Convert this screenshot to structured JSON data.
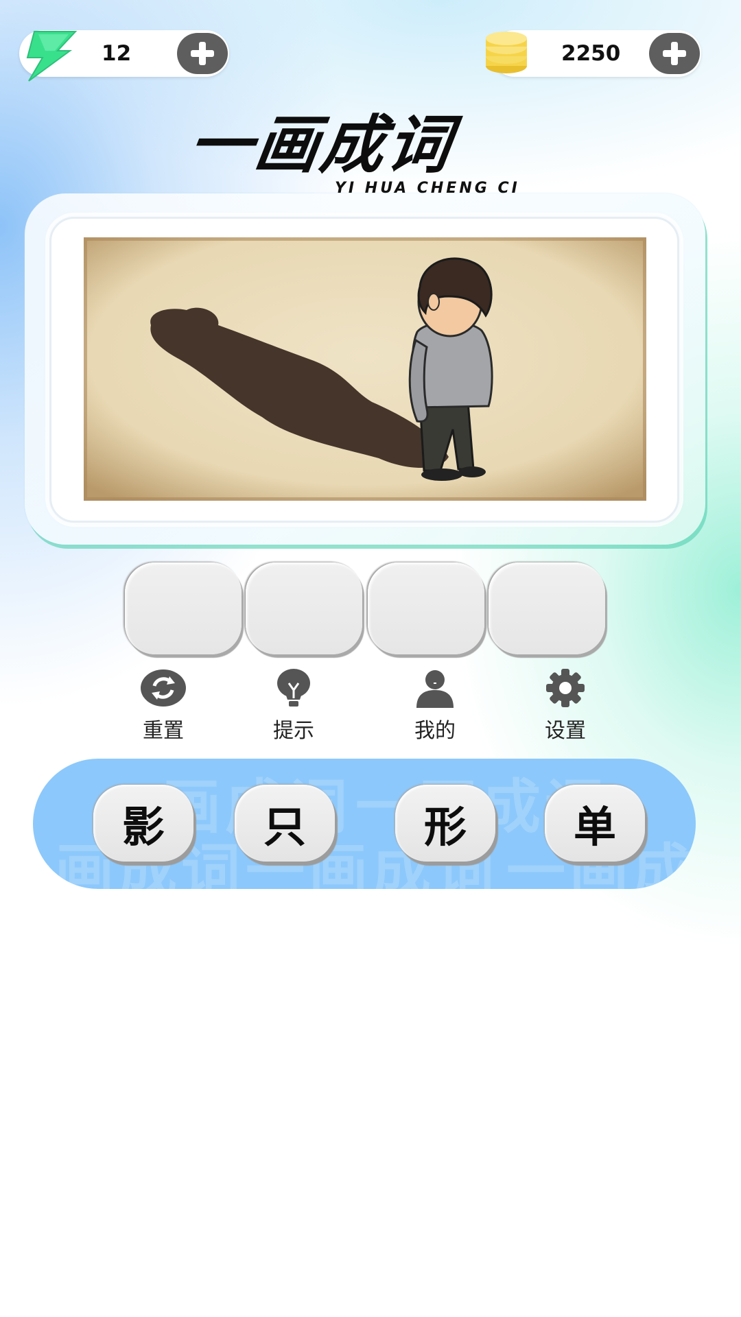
{
  "header": {
    "energy": {
      "icon": "lightning-bolt-icon",
      "value": "12",
      "add_icon": "plus-icon"
    },
    "coins": {
      "icon": "coin-stack-icon",
      "value": "2250",
      "add_icon": "plus-icon"
    }
  },
  "title": {
    "text": "一画成词",
    "subtitle": "YI HUA CHENG CI"
  },
  "puzzle": {
    "image": "man-looking-at-shadow-illustration",
    "answer_slots": [
      "",
      "",
      "",
      ""
    ]
  },
  "tools": [
    {
      "icon": "refresh-icon",
      "label": "重置"
    },
    {
      "icon": "lightbulb-icon",
      "label": "提示"
    },
    {
      "icon": "user-icon",
      "label": "我的"
    },
    {
      "icon": "gear-icon",
      "label": "设置"
    }
  ],
  "candidates": {
    "watermark_text": "一画成词",
    "chars": [
      "影",
      "只",
      "形",
      "单"
    ]
  },
  "colors": {
    "accent_blue": "#8cc8fb",
    "accent_mint": "#9ef0d8",
    "button_gray": "#5e5e5e",
    "bolt_green": "#39e08c",
    "coin_yellow": "#f6d44a"
  }
}
